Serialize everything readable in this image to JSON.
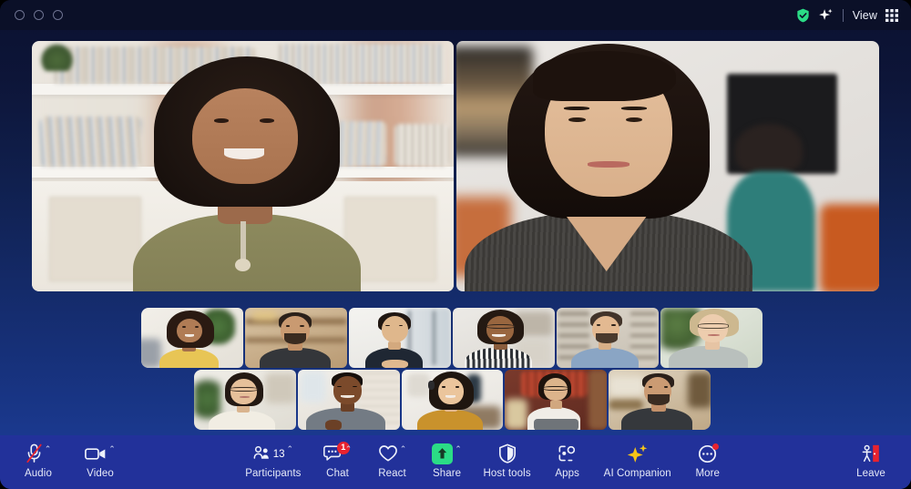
{
  "window": {
    "title_bar": {
      "traffic_lights": [
        "close",
        "minimize",
        "zoom"
      ],
      "encryption_icon": "shield-check-icon",
      "ai_icon": "sparkle-icon",
      "view_label": "View",
      "view_grid_icon": "grid-icon"
    }
  },
  "meeting": {
    "speakers": [
      {
        "id": "speaker-1",
        "name": "active-speaker-left"
      },
      {
        "id": "speaker-2",
        "name": "active-speaker-right"
      }
    ],
    "filmstrip": {
      "row1": [
        {
          "id": "thumb-1"
        },
        {
          "id": "thumb-2"
        },
        {
          "id": "thumb-3"
        },
        {
          "id": "thumb-4"
        },
        {
          "id": "thumb-5"
        },
        {
          "id": "thumb-6"
        }
      ],
      "row2": [
        {
          "id": "thumb-7"
        },
        {
          "id": "thumb-8"
        },
        {
          "id": "thumb-9"
        },
        {
          "id": "thumb-10"
        },
        {
          "id": "thumb-11"
        }
      ]
    }
  },
  "toolbar": {
    "audio": {
      "label": "Audio",
      "icon": "microphone-muted-icon",
      "caret": "⌃",
      "muted": true
    },
    "video": {
      "label": "Video",
      "icon": "video-camera-icon",
      "caret": "⌃"
    },
    "participants": {
      "label": "Participants",
      "icon": "participants-icon",
      "count": "13",
      "caret": "⌃"
    },
    "chat": {
      "label": "Chat",
      "icon": "chat-bubble-icon",
      "badge": "1",
      "caret": "⌃"
    },
    "react": {
      "label": "React",
      "icon": "heart-icon",
      "caret": "⌃"
    },
    "share": {
      "label": "Share",
      "icon": "share-screen-icon",
      "caret": "⌃"
    },
    "host_tools": {
      "label": "Host tools",
      "icon": "shield-icon"
    },
    "apps": {
      "label": "Apps",
      "icon": "apps-icon"
    },
    "ai_companion": {
      "label": "AI Companion",
      "icon": "sparkles-icon"
    },
    "more": {
      "label": "More",
      "icon": "more-circle-icon",
      "badge_dot": true
    },
    "leave": {
      "label": "Leave",
      "icon": "leave-door-icon"
    }
  },
  "colors": {
    "toolbar_bg": "#22319a",
    "titlebar_bg": "#0b1028",
    "share_green": "#2bdc86",
    "badge_red": "#e8232f",
    "leave_red": "#e8232f",
    "ai_gold": "#f5c518",
    "shield_green": "#2bdc86"
  }
}
